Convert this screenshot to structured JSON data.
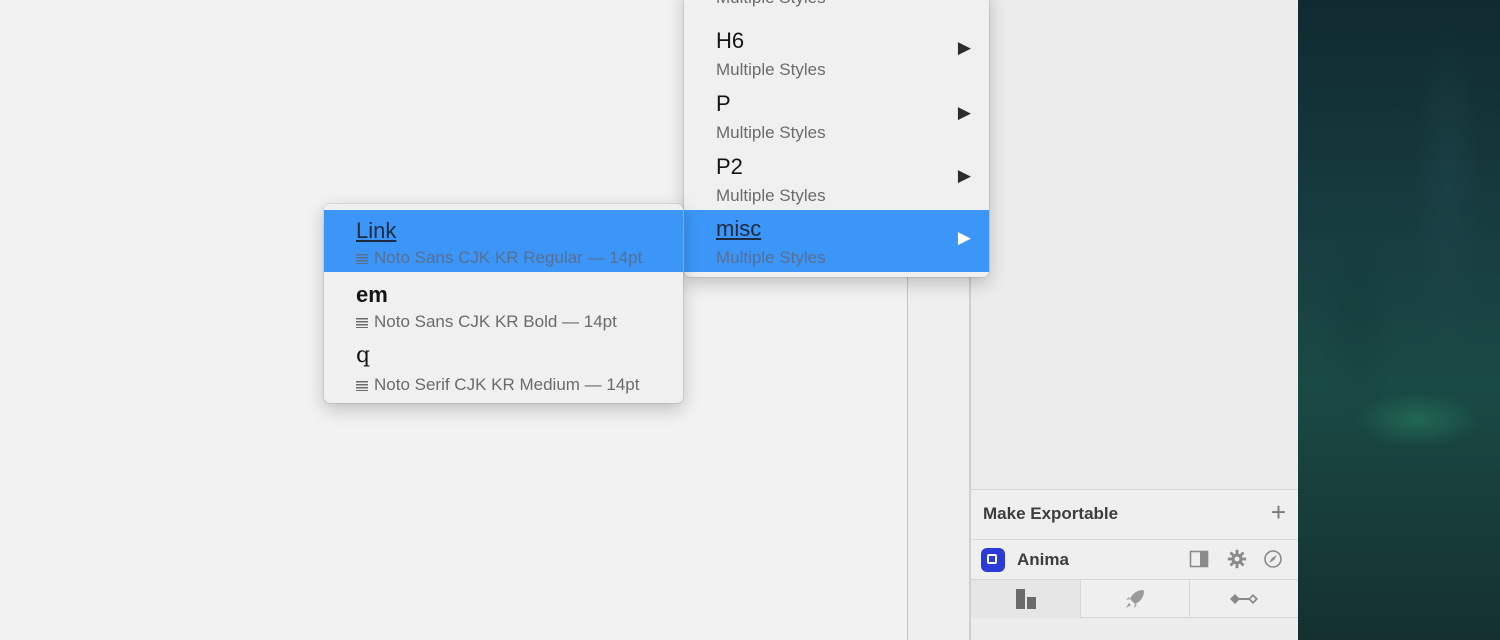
{
  "main_menu": {
    "items": [
      {
        "title": "",
        "subtitle": "Multiple Styles",
        "has_submenu": false,
        "highlighted": false
      },
      {
        "title": "H6",
        "subtitle": "Multiple Styles",
        "has_submenu": true,
        "highlighted": false
      },
      {
        "title": "P",
        "subtitle": "Multiple Styles",
        "has_submenu": true,
        "highlighted": false
      },
      {
        "title": "P2",
        "subtitle": "Multiple Styles",
        "has_submenu": true,
        "highlighted": false
      },
      {
        "title": "misc",
        "subtitle": "Multiple Styles",
        "has_submenu": true,
        "highlighted": true
      }
    ],
    "arrow_glyph": "▶"
  },
  "submenu": {
    "items": [
      {
        "title": "Link",
        "subtitle": "Noto Sans CJK KR Regular — 14pt",
        "highlighted": true
      },
      {
        "title": "em",
        "subtitle": "Noto Sans CJK KR Bold — 14pt",
        "highlighted": false
      },
      {
        "title": "q",
        "subtitle": "Noto Serif CJK KR Medium — 14pt",
        "highlighted": false
      }
    ]
  },
  "right_panel": {
    "export_title": "Make Exportable",
    "export_add": "+",
    "plugin_name": "Anima",
    "plugin_icons": [
      "panel-toggle-icon",
      "gear-icon",
      "compass-icon"
    ],
    "tabs": [
      {
        "name": "layout-tab",
        "icon": "layout-icon",
        "active": true
      },
      {
        "name": "launch-tab",
        "icon": "rocket-icon",
        "active": false
      },
      {
        "name": "timeline-tab",
        "icon": "keyframe-icon",
        "active": false
      }
    ]
  },
  "colors": {
    "highlight": "#3c96f8",
    "anima_brand": "#2b3bd8"
  }
}
